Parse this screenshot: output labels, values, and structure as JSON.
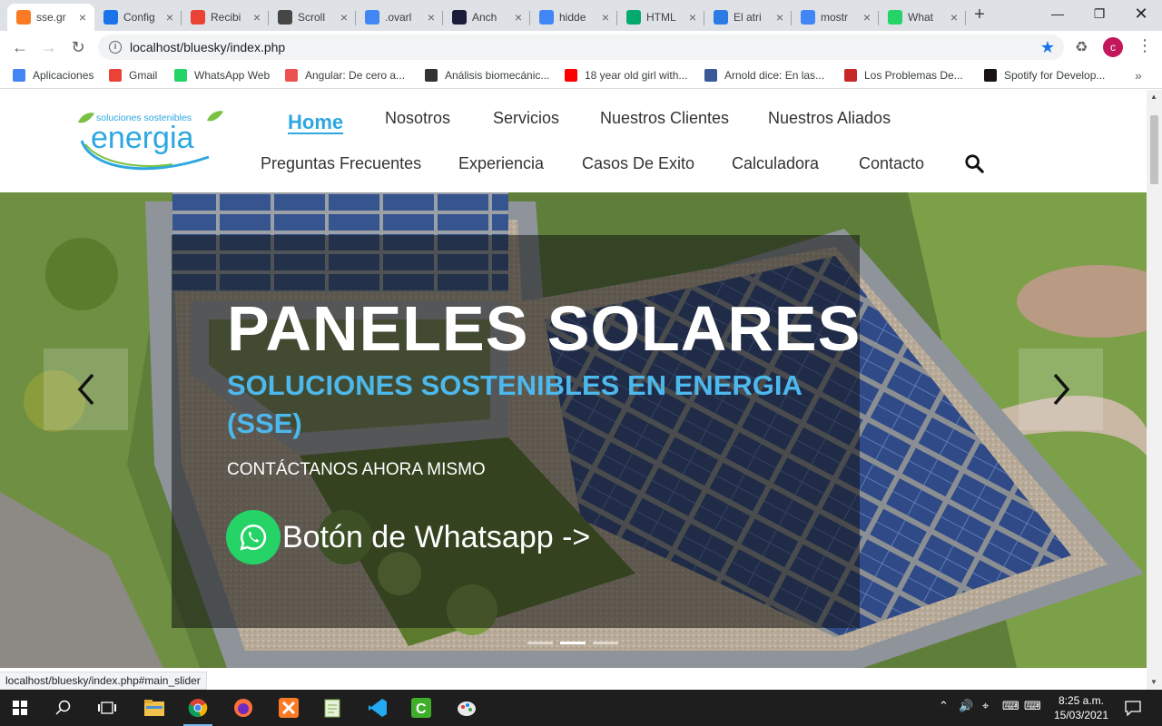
{
  "browser": {
    "tabs": [
      {
        "label": "sse.gr",
        "icon": "xampp-icon",
        "color": "#fb7a24",
        "active": true
      },
      {
        "label": "Config",
        "icon": "gear-icon",
        "color": "#1a73e8",
        "active": false
      },
      {
        "label": "Recibi",
        "icon": "gmail-icon",
        "color": "#ea4335",
        "active": false
      },
      {
        "label": "Scroll",
        "icon": "wordpress-icon",
        "color": "#464646",
        "active": false
      },
      {
        "label": ".ovarl",
        "icon": "google-icon",
        "color": "#4285f4",
        "active": false
      },
      {
        "label": "Anch",
        "icon": "angular-icon",
        "color": "#1b1b3a",
        "active": false
      },
      {
        "label": "hidde",
        "icon": "google-icon",
        "color": "#4285f4",
        "active": false
      },
      {
        "label": "HTML",
        "icon": "w3schools-icon",
        "color": "#04aa6d",
        "active": false
      },
      {
        "label": "El atri",
        "icon": "d-icon",
        "color": "#2c7be5",
        "active": false
      },
      {
        "label": "mostr",
        "icon": "google-icon",
        "color": "#4285f4",
        "active": false
      },
      {
        "label": "What",
        "icon": "whatsapp-icon",
        "color": "#25d366",
        "active": false
      }
    ],
    "url": "localhost/bluesky/index.php",
    "profile_initial": "c",
    "bookmarks": [
      {
        "label": "Aplicaciones",
        "icon": "apps-grid-icon",
        "color": "#4285f4"
      },
      {
        "label": "Gmail",
        "icon": "gmail-icon",
        "color": "#ea4335"
      },
      {
        "label": "WhatsApp Web",
        "icon": "whatsapp-icon",
        "color": "#25d366"
      },
      {
        "label": "Angular: De cero a...",
        "icon": "udemy-icon",
        "color": "#ec5252"
      },
      {
        "label": "Análisis biomecánic...",
        "icon": "pkp-icon",
        "color": "#333333"
      },
      {
        "label": "18 year old girl with...",
        "icon": "youtube-icon",
        "color": "#ff0000"
      },
      {
        "label": "Arnold dice: En las...",
        "icon": "site-icon",
        "color": "#3b5998"
      },
      {
        "label": "Los Problemas De...",
        "icon": "site-icon",
        "color": "#c62828"
      },
      {
        "label": "Spotify for Develop...",
        "icon": "spotify-icon",
        "color": "#191414"
      }
    ],
    "status_url": "localhost/bluesky/index.php#main_slider"
  },
  "site": {
    "logo": {
      "top_text": "soluciones sostenibles",
      "word": "energia"
    },
    "nav_row1": [
      "Home",
      "Nosotros",
      "Servicios",
      "Nuestros Clientes",
      "Nuestros Aliados"
    ],
    "nav_row2": [
      "Preguntas Frecuentes",
      "Experiencia",
      "Casos De Exito",
      "Calculadora",
      "Contacto"
    ],
    "hero": {
      "title": "PANELES SOLARES",
      "subtitle": "SOLUCIONES SOSTENIBLES EN ENERGIA (SSE)",
      "cta": "CONTÁCTANOS AHORA MISMO",
      "whatsapp_label": "Botón de Whatsapp ->",
      "active_slide": 2,
      "slide_count": 3
    },
    "colors": {
      "accent": "#2ea7e0",
      "whatsapp": "#25d366",
      "logo_green": "#7ac143"
    }
  },
  "taskbar": {
    "time": "8:25 a.m.",
    "date": "15/03/2021"
  }
}
